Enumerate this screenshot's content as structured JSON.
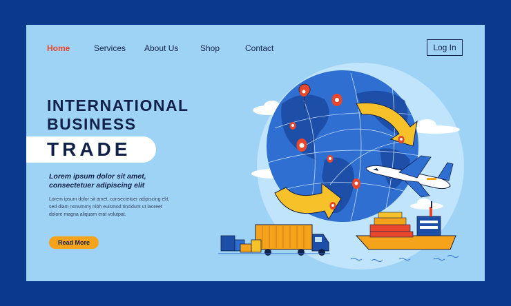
{
  "nav": {
    "items": [
      "Home",
      "Services",
      "About Us",
      "Shop",
      "Contact"
    ],
    "active": "Home",
    "login": "Log In"
  },
  "hero": {
    "title_line1": "INTERNATIONAL",
    "title_line2": "BUSINESS",
    "title_highlight": "TRADE",
    "subtitle_line1": "Lorem ipsum dolor sit amet,",
    "subtitle_line2": "consectetuer adipiscing elit",
    "body_line1": "Lorem ipsum dolor sit amet, consectetuer adipiscing elit,",
    "body_line2": "sed diam nonummy nibh euismod tincidunt ut laoreet",
    "body_line3": "dolore magna aliquam erat volutpat.",
    "cta": "Read More"
  },
  "colors": {
    "frame": "#0b3a8c",
    "page_bg": "#9fd3f5",
    "accent_red": "#e8472b",
    "accent_orange": "#f5a31a",
    "text_dark": "#12214a",
    "globe_blue": "#2f6fd1",
    "land_blue": "#1d4fa8"
  },
  "icons": [
    "globe-icon",
    "airplane-icon",
    "cargo-ship-icon",
    "truck-icon",
    "location-pin-icon",
    "arrow-icon",
    "cloud-icon",
    "box-icon"
  ]
}
